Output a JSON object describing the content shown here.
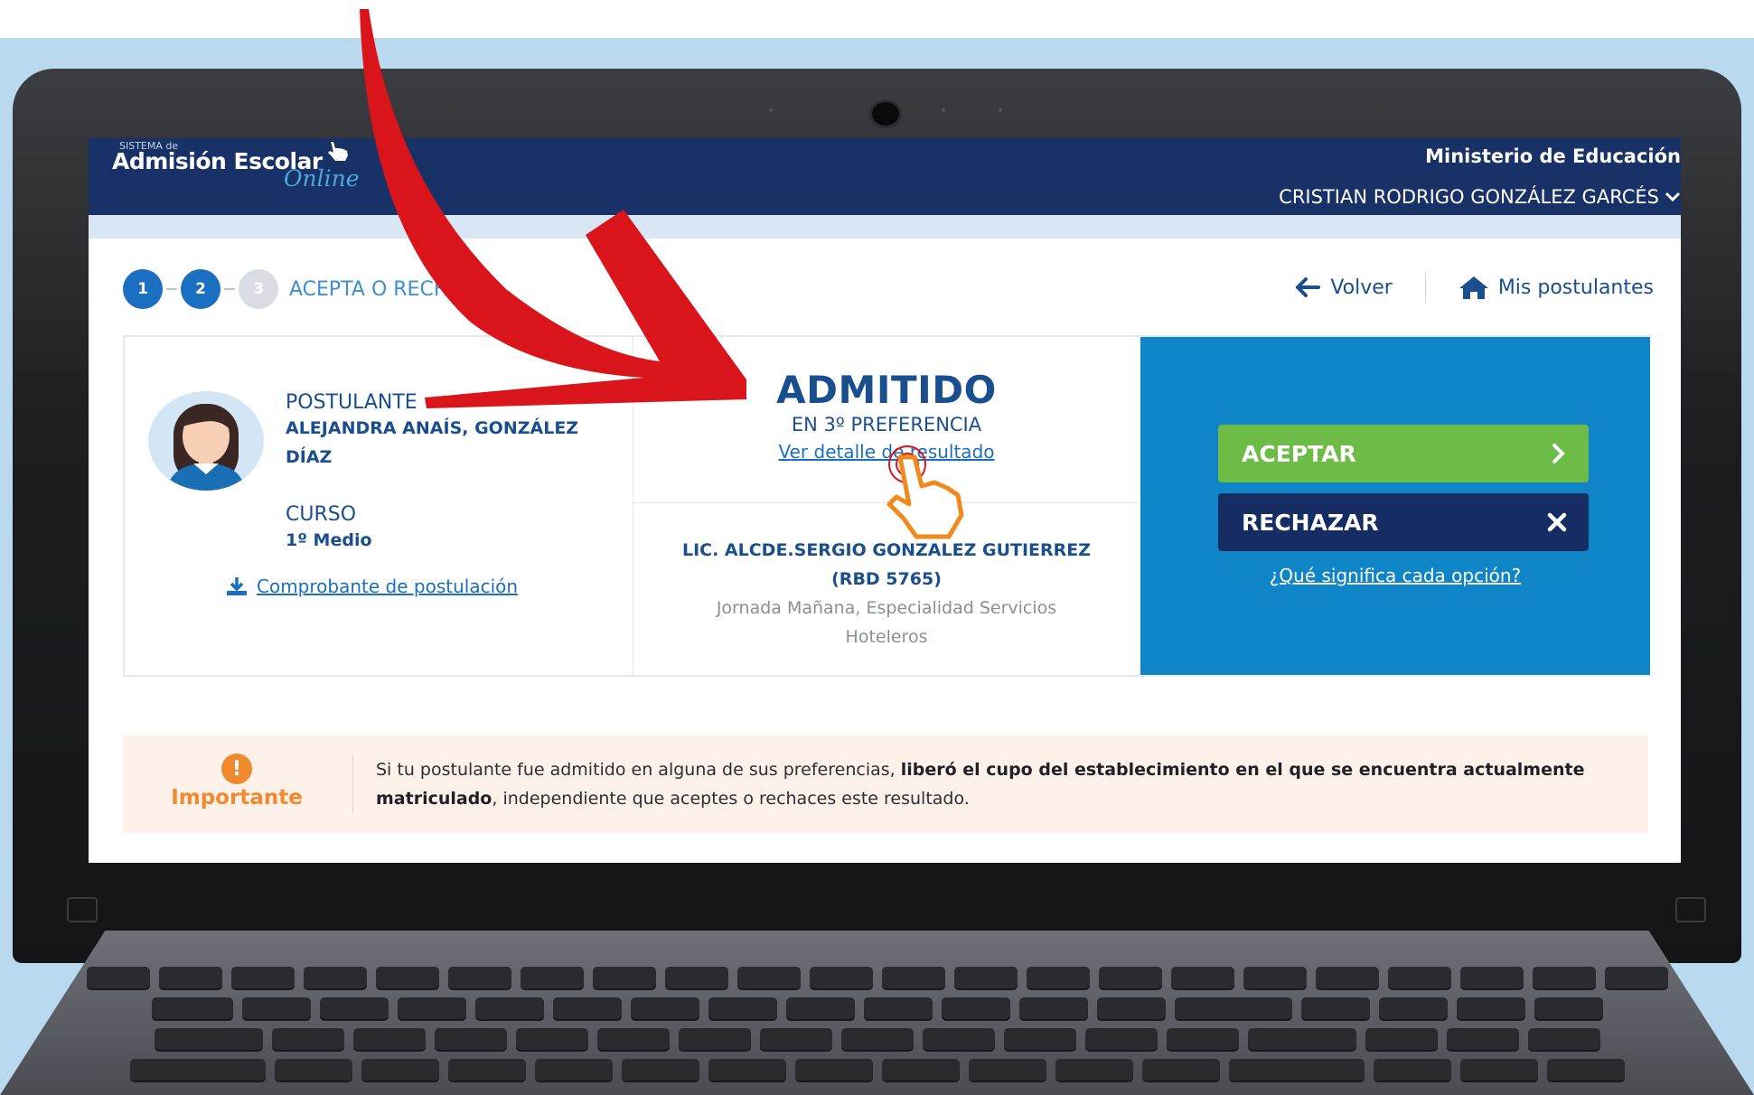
{
  "header": {
    "logo_small": "SISTEMA de",
    "logo_main": "Admisión Escolar",
    "logo_script": "Online",
    "ministry": "Ministerio de Educación",
    "user_name": "CRISTIAN RODRIGO GONZÁLEZ GARCÉS"
  },
  "steps": {
    "items": [
      "1",
      "2",
      "3"
    ],
    "current_label": "ACEPTA O RECHAZA"
  },
  "nav": {
    "back_label": "Volver",
    "applicants_label": "Mis postulantes"
  },
  "applicant": {
    "label": "POSTULANTE",
    "name": "ALEJANDRA ANAÍS, GONZÁLEZ DÍAZ",
    "course_label": "CURSO",
    "course": "1º Medio",
    "receipt_link": "Comprobante de postulación"
  },
  "result": {
    "status": "ADMITIDO",
    "preference": "EN 3º PREFERENCIA",
    "detail_link": "Ver detalle de resultado",
    "school_name": "LIC. ALCDE.SERGIO GONZALEZ GUTIERREZ",
    "school_rbd": "(RBD 5765)",
    "school_details": "Jornada Mañana, Especialidad Servicios Hoteleros"
  },
  "actions": {
    "accept_label": "ACEPTAR",
    "reject_label": "RECHAZAR",
    "help_link": "¿Qué significa cada opción?"
  },
  "notice": {
    "title": "Importante",
    "text_pre": "Si tu postulante fue admitido en alguna de sus preferencias, ",
    "text_bold": "liberó el cupo del establecimiento en el que se encuentra actualmente matriculado",
    "text_post": ", independiente que aceptes o rechaces este resultado."
  },
  "colors": {
    "header_bg": "#183167",
    "brand_blue": "#1a4f8f",
    "action_panel": "#0f85c8",
    "accept": "#6cbc47",
    "reject": "#162d63",
    "notice_accent": "#ef8a2f",
    "annotation_arrow": "#d9141b"
  },
  "icons": {
    "back": "arrow-left-icon",
    "home": "home-icon",
    "download": "download-icon",
    "accept": "chevron-right-icon",
    "reject": "close-icon",
    "notice": "exclamation-icon",
    "pointer": "hand-pointer-icon"
  }
}
